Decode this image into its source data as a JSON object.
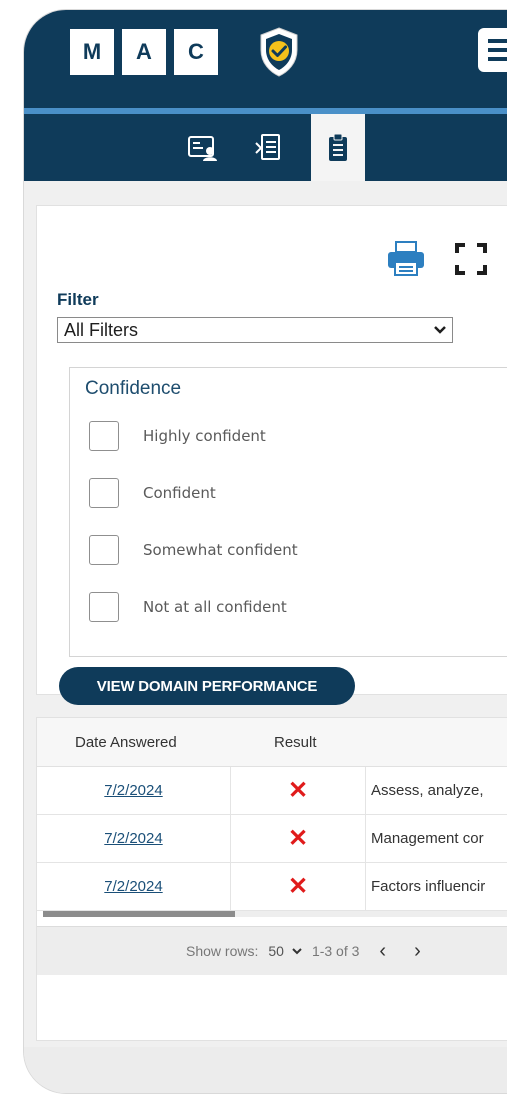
{
  "header": {
    "logo_letters": [
      "M",
      "A",
      "C"
    ],
    "icons": [
      "shield-check-icon",
      "hamburger-menu-icon"
    ],
    "brand_color": "#0f3b5a",
    "accent_color": "#4a90c8"
  },
  "tabs": [
    {
      "icon": "profile-card-icon",
      "active": false
    },
    {
      "icon": "document-list-icon",
      "active": false
    },
    {
      "icon": "clipboard-icon",
      "active": true
    }
  ],
  "filter_panel": {
    "toolbar_icons": [
      "print-icon",
      "fullscreen-icon"
    ],
    "filter_label": "Filter",
    "filter_selected": "All Filters",
    "confidence": {
      "title": "Confidence",
      "options": [
        {
          "label": "Highly confident",
          "checked": false
        },
        {
          "label": "Confident",
          "checked": false
        },
        {
          "label": "Somewhat confident",
          "checked": false
        },
        {
          "label": "Not at all confident",
          "checked": false
        }
      ]
    },
    "view_button_label": "VIEW DOMAIN PERFORMANCE"
  },
  "results_table": {
    "columns": [
      "Date Answered",
      "Result"
    ],
    "rows": [
      {
        "date": "7/2/2024",
        "result": "✕",
        "description": "Assess, analyze,"
      },
      {
        "date": "7/2/2024",
        "result": "✕",
        "description": "Management cor"
      },
      {
        "date": "7/2/2024",
        "result": "✕",
        "description": "Factors influencir"
      }
    ],
    "result_color": "#e01b1b",
    "pager": {
      "show_rows_label": "Show rows:",
      "rows_value": "50",
      "range_text": "1-3 of 3",
      "prev_label": "‹",
      "next_label": "›"
    }
  }
}
